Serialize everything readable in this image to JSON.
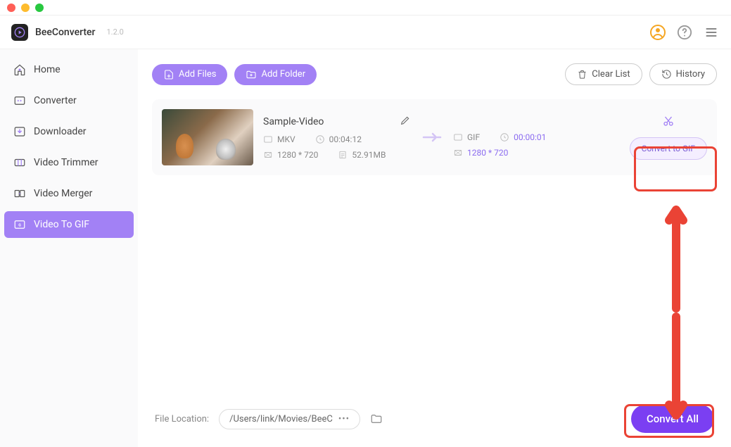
{
  "app": {
    "name": "BeeConverter",
    "version": "1.2.0"
  },
  "sidebar": {
    "items": [
      {
        "label": "Home"
      },
      {
        "label": "Converter"
      },
      {
        "label": "Downloader"
      },
      {
        "label": "Video Trimmer"
      },
      {
        "label": "Video Merger"
      },
      {
        "label": "Video To GIF"
      }
    ]
  },
  "toolbar": {
    "add_files": "Add Files",
    "add_folder": "Add Folder",
    "clear_list": "Clear List",
    "history": "History"
  },
  "item": {
    "title": "Sample-Video",
    "source": {
      "format": "MKV",
      "duration": "00:04:12",
      "resolution": "1280 * 720",
      "size": "52.91MB"
    },
    "target": {
      "format": "GIF",
      "duration": "00:00:01",
      "resolution": "1280 * 720"
    },
    "convert_label": "Convert to GIF"
  },
  "bottom": {
    "label": "File Location:",
    "path": "/Users/link/Movies/BeeC",
    "convert_all": "Convert All"
  }
}
